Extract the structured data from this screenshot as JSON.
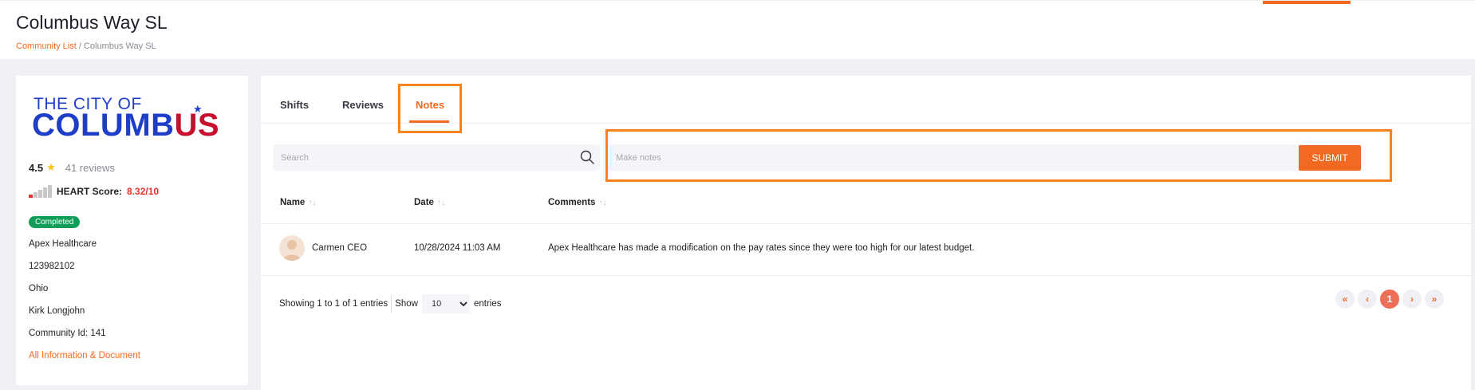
{
  "header": {
    "title": "Columbus Way SL",
    "breadcrumb": {
      "parent": "Community List",
      "separator": " / ",
      "current": "Columbus Way SL"
    }
  },
  "community": {
    "logo_line1": "THE CITY OF",
    "logo_line2_a": "COLUMB",
    "logo_line2_b": "US",
    "rating": "4.5",
    "reviews": "41 reviews",
    "heart_label": "HEART Score:",
    "heart_value": "8.32/10",
    "status": "Completed",
    "company": "Apex Healthcare",
    "phone": "123982102",
    "state": "Ohio",
    "contact": "Kirk Longjohn",
    "community_id": "Community Id: 141",
    "info_link": "All Information & Document",
    "colors": {
      "accent": "#f26a21",
      "badge": "#0f9d58",
      "heart": "#e4322b",
      "logo_blue": "#1e3ec8",
      "logo_red": "#c8102e"
    }
  },
  "tabs": [
    {
      "label": "Shifts",
      "active": false
    },
    {
      "label": "Reviews",
      "active": false
    },
    {
      "label": "Notes",
      "active": true
    }
  ],
  "search": {
    "placeholder": "Search",
    "icon": "search-icon"
  },
  "notes": {
    "placeholder": "Make notes",
    "submit_label": "SUBMIT"
  },
  "table": {
    "columns": [
      "Name",
      "Date",
      "Comments"
    ],
    "rows": [
      {
        "name": "Carmen CEO",
        "date": "10/28/2024 11:03 AM",
        "comment": "Apex Healthcare has made a modification on the pay rates since they were too high for our latest budget."
      }
    ]
  },
  "footer": {
    "showing": "Showing 1 to 1 of 1 entries",
    "show_label": "Show",
    "page_size": "10",
    "entries_label": "entries"
  },
  "pagination": {
    "first": "«",
    "prev": "‹",
    "current": "1",
    "next": "›",
    "last": "»"
  }
}
